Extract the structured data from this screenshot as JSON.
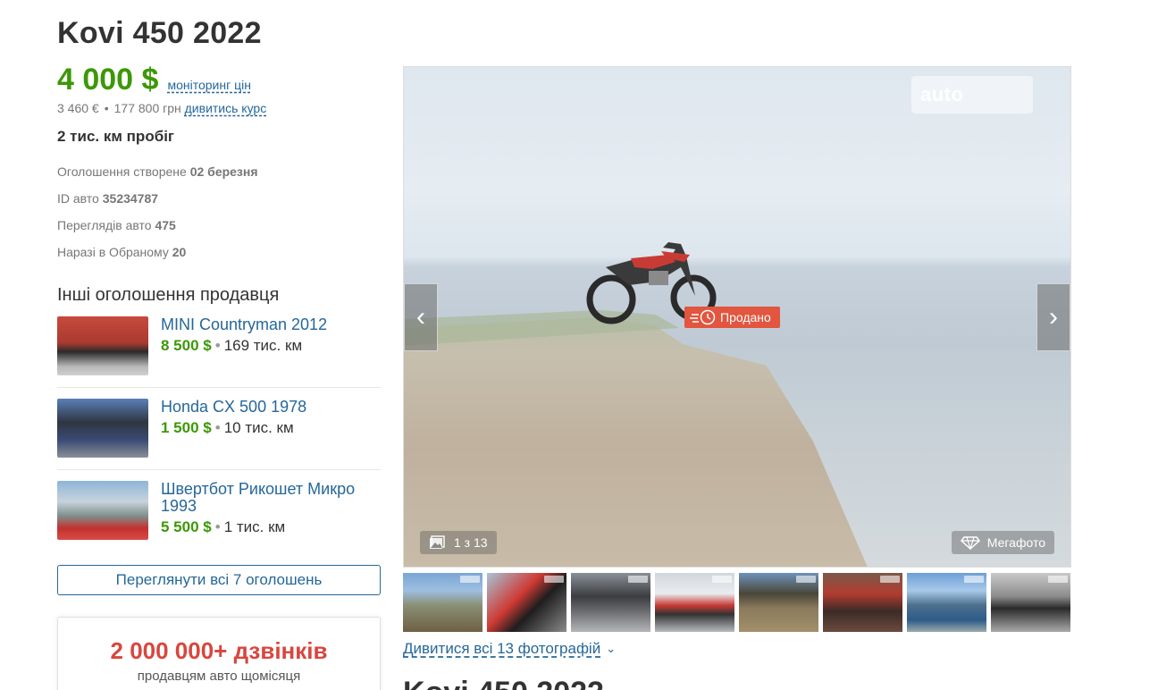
{
  "listing": {
    "title": "Kovi 450 2022",
    "price_usd": "4 000 $",
    "price_monitor_link": "моніторинг цін",
    "price_eur": "3 460 €",
    "price_uah": "177 800 грн",
    "exchange_link": "дивитись курс",
    "mileage": "2 тис. км пробіг",
    "created_label": "Оголошення створене",
    "created_value": "02 березня",
    "id_label": "ID авто",
    "id_value": "35234787",
    "views_label": "Переглядів авто",
    "views_value": "475",
    "favorites_label": "Наразі в Обраному",
    "favorites_value": "20"
  },
  "other_listings": {
    "title": "Інші оголошення продавця",
    "items": [
      {
        "name": "MINI Countryman 2012",
        "price": "8 500 $",
        "mileage": "169 тис. км"
      },
      {
        "name": "Honda CX 500 1978",
        "price": "1 500 $",
        "mileage": "10 тис. км"
      },
      {
        "name": "Швертбот Рикошет Микро 1993",
        "price": "5 500 $",
        "mileage": "1 тис. км"
      }
    ],
    "view_all_label": "Переглянути всі 7 оголошень"
  },
  "promo": {
    "headline": "2 000 000+ дзвінків",
    "subline": "продавцям авто щомісяця"
  },
  "gallery": {
    "watermark": "auto",
    "sold_badge": "Продано",
    "counter": "1 з 13",
    "megaphoto_label": "Мегафото",
    "prev_icon": "‹",
    "next_icon": "›",
    "view_all_photos": "Дивитися всі 13 фотографій",
    "thumbnail_count": 8
  },
  "colors": {
    "price_green": "#3c9806",
    "link_blue": "#256799",
    "sold_red": "#e2553f",
    "promo_red": "#d8463e"
  },
  "icons": [
    "chevron-left-icon",
    "chevron-right-icon",
    "gallery-icon",
    "megaphoto-diamond-icon",
    "sold-clock-icon",
    "chevron-down-icon"
  ]
}
